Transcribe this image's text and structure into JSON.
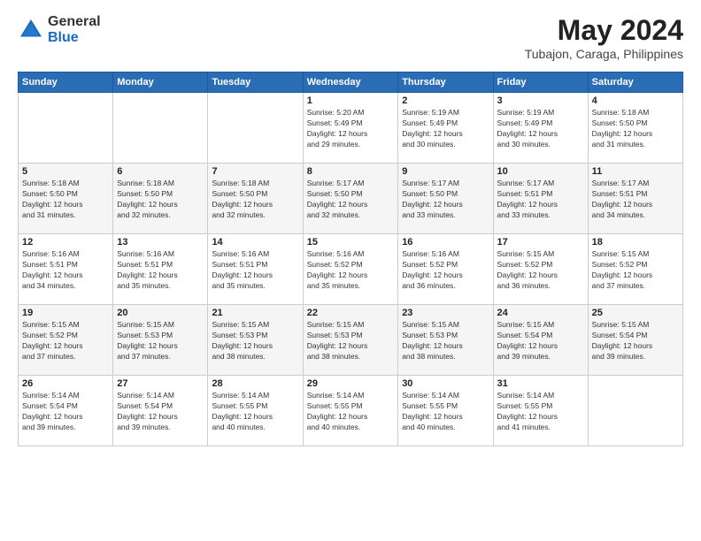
{
  "header": {
    "logo_general": "General",
    "logo_blue": "Blue",
    "main_title": "May 2024",
    "subtitle": "Tubajon, Caraga, Philippines"
  },
  "calendar": {
    "days_of_week": [
      "Sunday",
      "Monday",
      "Tuesday",
      "Wednesday",
      "Thursday",
      "Friday",
      "Saturday"
    ],
    "weeks": [
      [
        {
          "day": "",
          "info": ""
        },
        {
          "day": "",
          "info": ""
        },
        {
          "day": "",
          "info": ""
        },
        {
          "day": "1",
          "info": "Sunrise: 5:20 AM\nSunset: 5:49 PM\nDaylight: 12 hours\nand 29 minutes."
        },
        {
          "day": "2",
          "info": "Sunrise: 5:19 AM\nSunset: 5:49 PM\nDaylight: 12 hours\nand 30 minutes."
        },
        {
          "day": "3",
          "info": "Sunrise: 5:19 AM\nSunset: 5:49 PM\nDaylight: 12 hours\nand 30 minutes."
        },
        {
          "day": "4",
          "info": "Sunrise: 5:18 AM\nSunset: 5:50 PM\nDaylight: 12 hours\nand 31 minutes."
        }
      ],
      [
        {
          "day": "5",
          "info": "Sunrise: 5:18 AM\nSunset: 5:50 PM\nDaylight: 12 hours\nand 31 minutes."
        },
        {
          "day": "6",
          "info": "Sunrise: 5:18 AM\nSunset: 5:50 PM\nDaylight: 12 hours\nand 32 minutes."
        },
        {
          "day": "7",
          "info": "Sunrise: 5:18 AM\nSunset: 5:50 PM\nDaylight: 12 hours\nand 32 minutes."
        },
        {
          "day": "8",
          "info": "Sunrise: 5:17 AM\nSunset: 5:50 PM\nDaylight: 12 hours\nand 32 minutes."
        },
        {
          "day": "9",
          "info": "Sunrise: 5:17 AM\nSunset: 5:50 PM\nDaylight: 12 hours\nand 33 minutes."
        },
        {
          "day": "10",
          "info": "Sunrise: 5:17 AM\nSunset: 5:51 PM\nDaylight: 12 hours\nand 33 minutes."
        },
        {
          "day": "11",
          "info": "Sunrise: 5:17 AM\nSunset: 5:51 PM\nDaylight: 12 hours\nand 34 minutes."
        }
      ],
      [
        {
          "day": "12",
          "info": "Sunrise: 5:16 AM\nSunset: 5:51 PM\nDaylight: 12 hours\nand 34 minutes."
        },
        {
          "day": "13",
          "info": "Sunrise: 5:16 AM\nSunset: 5:51 PM\nDaylight: 12 hours\nand 35 minutes."
        },
        {
          "day": "14",
          "info": "Sunrise: 5:16 AM\nSunset: 5:51 PM\nDaylight: 12 hours\nand 35 minutes."
        },
        {
          "day": "15",
          "info": "Sunrise: 5:16 AM\nSunset: 5:52 PM\nDaylight: 12 hours\nand 35 minutes."
        },
        {
          "day": "16",
          "info": "Sunrise: 5:16 AM\nSunset: 5:52 PM\nDaylight: 12 hours\nand 36 minutes."
        },
        {
          "day": "17",
          "info": "Sunrise: 5:15 AM\nSunset: 5:52 PM\nDaylight: 12 hours\nand 36 minutes."
        },
        {
          "day": "18",
          "info": "Sunrise: 5:15 AM\nSunset: 5:52 PM\nDaylight: 12 hours\nand 37 minutes."
        }
      ],
      [
        {
          "day": "19",
          "info": "Sunrise: 5:15 AM\nSunset: 5:52 PM\nDaylight: 12 hours\nand 37 minutes."
        },
        {
          "day": "20",
          "info": "Sunrise: 5:15 AM\nSunset: 5:53 PM\nDaylight: 12 hours\nand 37 minutes."
        },
        {
          "day": "21",
          "info": "Sunrise: 5:15 AM\nSunset: 5:53 PM\nDaylight: 12 hours\nand 38 minutes."
        },
        {
          "day": "22",
          "info": "Sunrise: 5:15 AM\nSunset: 5:53 PM\nDaylight: 12 hours\nand 38 minutes."
        },
        {
          "day": "23",
          "info": "Sunrise: 5:15 AM\nSunset: 5:53 PM\nDaylight: 12 hours\nand 38 minutes."
        },
        {
          "day": "24",
          "info": "Sunrise: 5:15 AM\nSunset: 5:54 PM\nDaylight: 12 hours\nand 39 minutes."
        },
        {
          "day": "25",
          "info": "Sunrise: 5:15 AM\nSunset: 5:54 PM\nDaylight: 12 hours\nand 39 minutes."
        }
      ],
      [
        {
          "day": "26",
          "info": "Sunrise: 5:14 AM\nSunset: 5:54 PM\nDaylight: 12 hours\nand 39 minutes."
        },
        {
          "day": "27",
          "info": "Sunrise: 5:14 AM\nSunset: 5:54 PM\nDaylight: 12 hours\nand 39 minutes."
        },
        {
          "day": "28",
          "info": "Sunrise: 5:14 AM\nSunset: 5:55 PM\nDaylight: 12 hours\nand 40 minutes."
        },
        {
          "day": "29",
          "info": "Sunrise: 5:14 AM\nSunset: 5:55 PM\nDaylight: 12 hours\nand 40 minutes."
        },
        {
          "day": "30",
          "info": "Sunrise: 5:14 AM\nSunset: 5:55 PM\nDaylight: 12 hours\nand 40 minutes."
        },
        {
          "day": "31",
          "info": "Sunrise: 5:14 AM\nSunset: 5:55 PM\nDaylight: 12 hours\nand 41 minutes."
        },
        {
          "day": "",
          "info": ""
        }
      ]
    ]
  }
}
